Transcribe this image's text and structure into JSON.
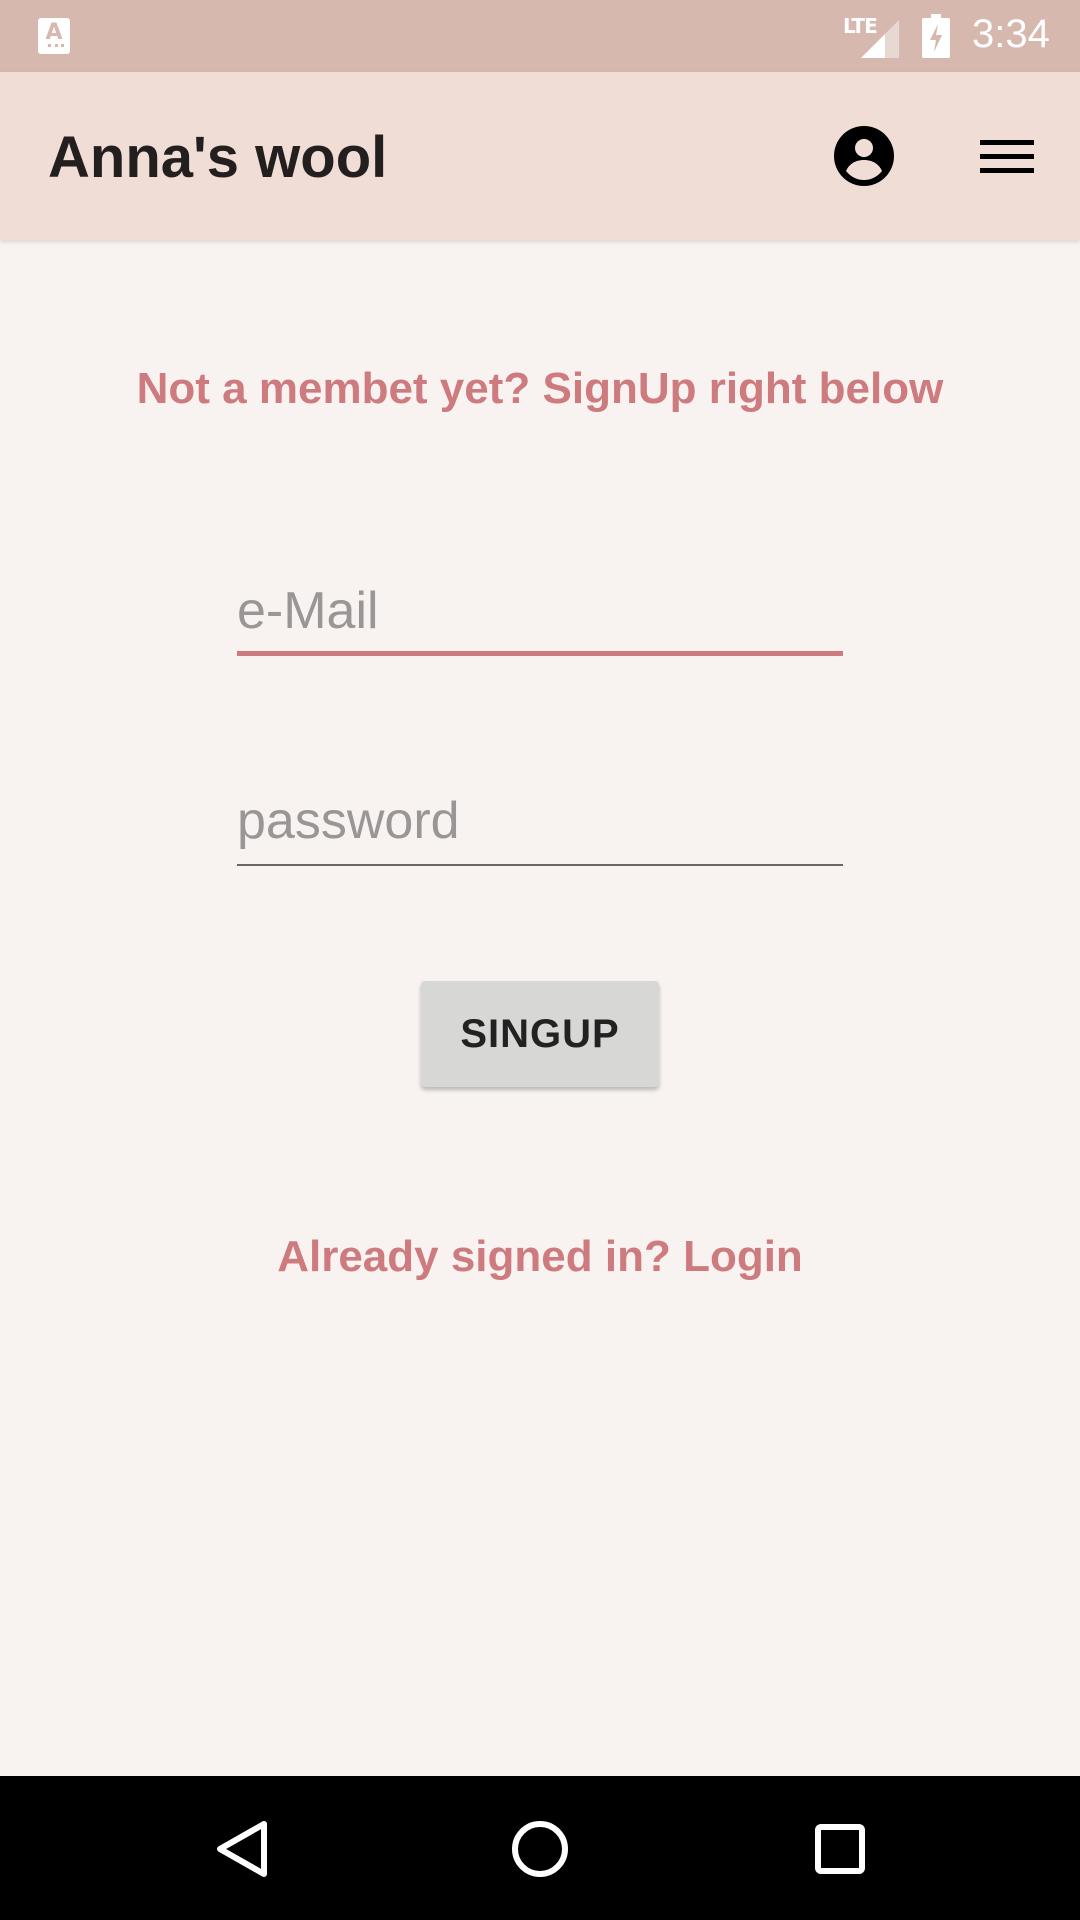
{
  "status_bar": {
    "time": "3:34",
    "network": "LTE",
    "app_icon_glyph": "A"
  },
  "app_bar": {
    "title": "Anna's wool",
    "icons": [
      "account-circle-icon",
      "menu-icon"
    ]
  },
  "signup": {
    "prompt": "Not a membet yet? SignUp right below",
    "email_placeholder": "e-Mail",
    "email_value": "",
    "password_placeholder": "password",
    "password_value": "",
    "button_label": "SINGUP",
    "login_link": "Already signed in? Login"
  },
  "nav_bar": {
    "buttons": [
      "back-icon",
      "home-icon",
      "recent-apps-icon"
    ]
  },
  "colors": {
    "status_bar": "#d6b8ae",
    "app_bar": "#efddd6",
    "background": "#f8f3f1",
    "accent": "#cd7b7e",
    "button": "#d7d7d5"
  }
}
